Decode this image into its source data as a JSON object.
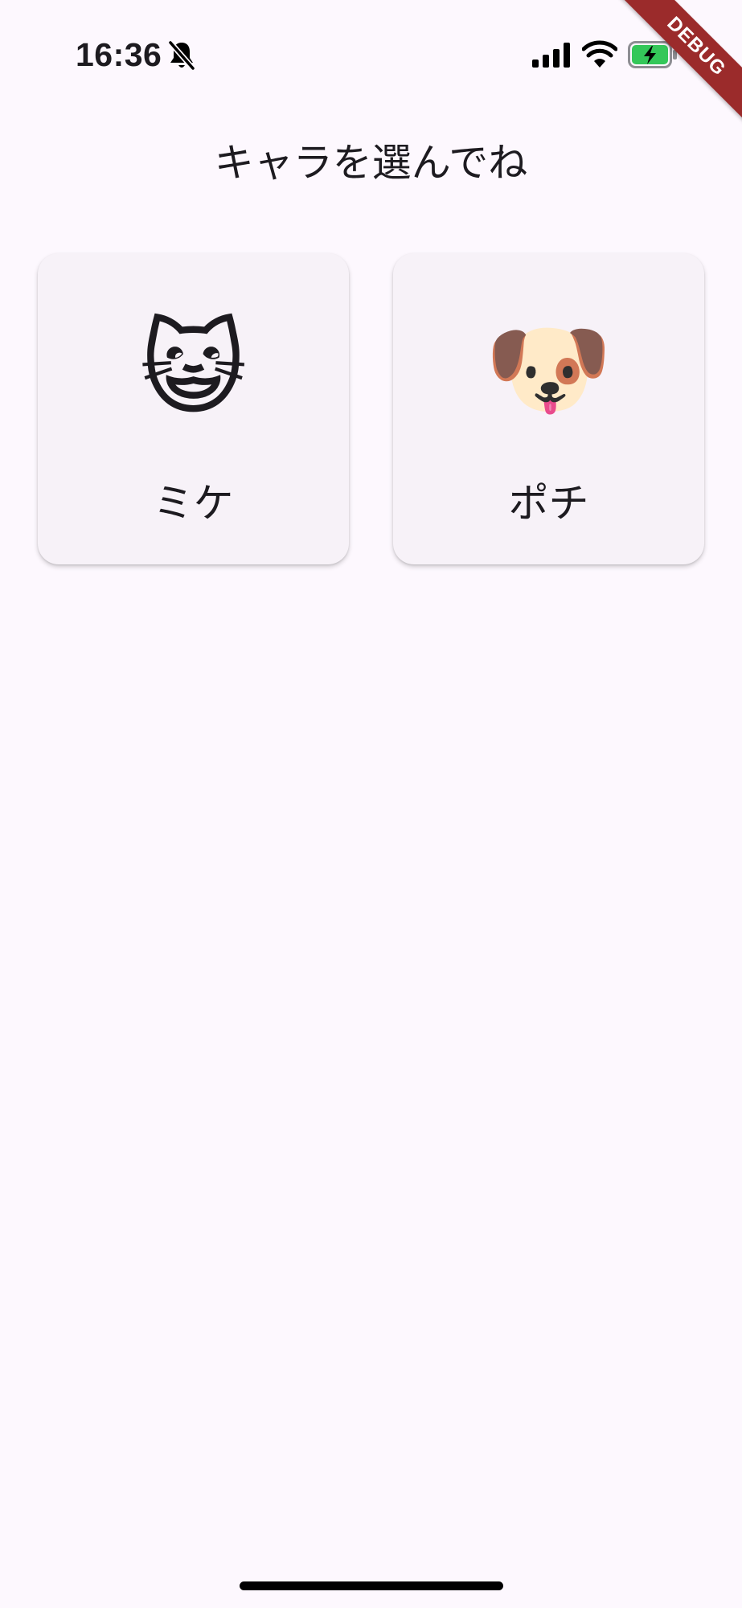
{
  "status_bar": {
    "time": "16:36",
    "icons": [
      "bell-slash-icon",
      "cellular-signal-icon",
      "wifi-icon",
      "battery-charging-icon"
    ],
    "battery_color": "#34c759"
  },
  "debug_banner": {
    "label": "DEBUG",
    "color": "#9b2b2b"
  },
  "page": {
    "title": "キャラを選んでね",
    "background": "#fdf8fe"
  },
  "characters": [
    {
      "emoji": "😺",
      "name": "ミケ",
      "icon": "grinning-cat-icon"
    },
    {
      "emoji": "🐶",
      "name": "ポチ",
      "icon": "dog-face-icon"
    }
  ]
}
